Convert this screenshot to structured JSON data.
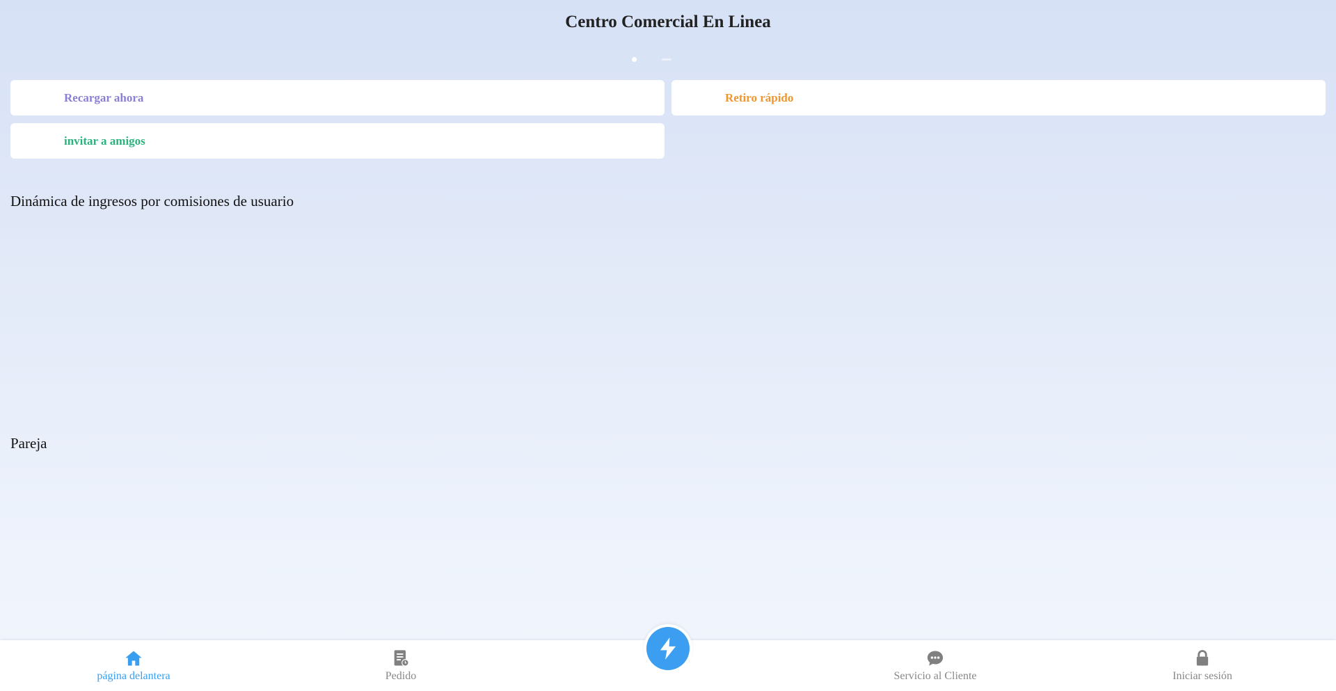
{
  "header": {
    "title": "Centro Comercial En Linea"
  },
  "quick_actions": {
    "recharge_label": "Recargar ahora",
    "withdraw_label": "Retiro rápido",
    "invite_label": "invitar a amigos"
  },
  "sections": {
    "dynamics_title": "Dinámica de ingresos por comisiones de usuario",
    "pair_title": "Pareja"
  },
  "bottom_nav": {
    "items": [
      {
        "label": "página delantera",
        "icon": "home-icon",
        "active": true
      },
      {
        "label": "Pedido",
        "icon": "order-icon",
        "active": false
      },
      {
        "label": "Servicio al Cliente",
        "icon": "chat-icon",
        "active": false
      },
      {
        "label": "Iniciar sesión",
        "icon": "lock-icon",
        "active": false
      }
    ],
    "center_icon": "lightning-icon"
  },
  "colors": {
    "accent": "#3a9ef0",
    "recharge": "#8a7fd6",
    "withdraw": "#f0962e",
    "invite": "#2bb27e",
    "nav_inactive": "#888888"
  }
}
